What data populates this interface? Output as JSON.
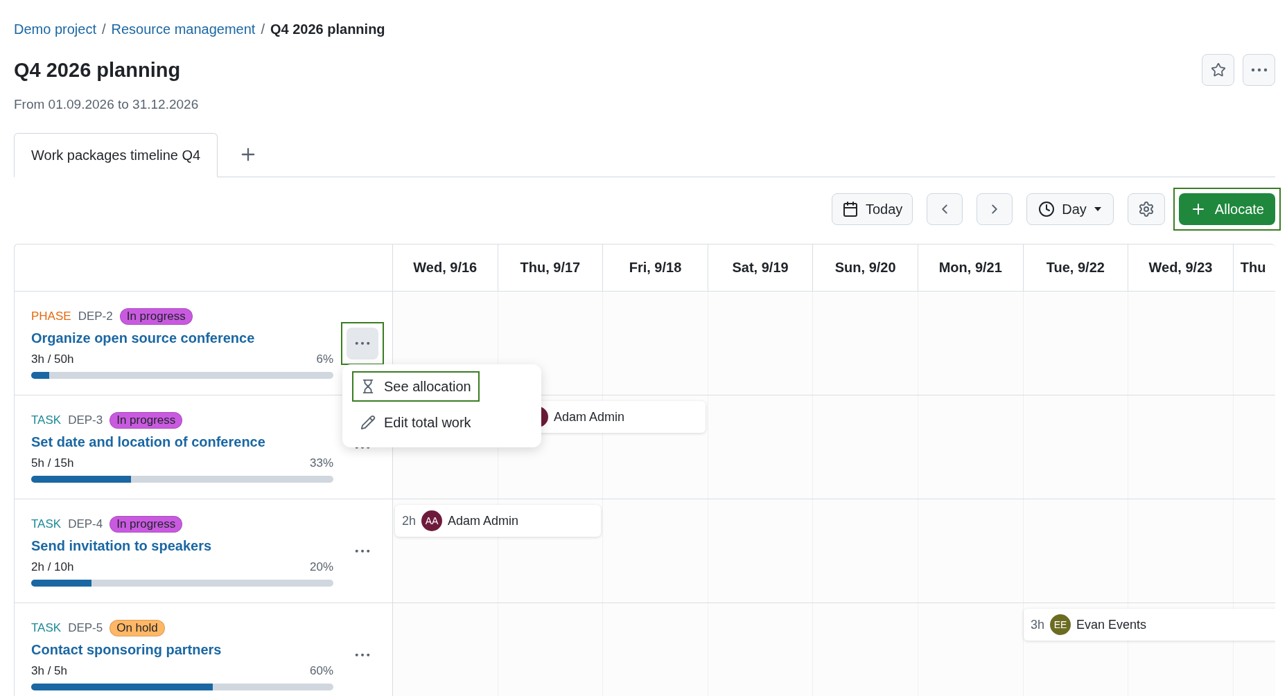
{
  "breadcrumb": [
    {
      "label": "Demo project",
      "kind": "link"
    },
    {
      "label": "Resource management",
      "kind": "link"
    },
    {
      "label": "Q4 2026 planning",
      "kind": "current"
    }
  ],
  "separator": "/",
  "title": "Q4 2026 planning",
  "subtitle": "From 01.09.2026 to 31.12.2026",
  "tabs": [
    {
      "label": "Work packages timeline Q4",
      "selected": true
    }
  ],
  "toolbar": [
    {
      "kind": "today",
      "label": "Today"
    },
    {
      "kind": "prev"
    },
    {
      "kind": "next"
    },
    {
      "kind": "view",
      "label": "Day"
    },
    {
      "kind": "settings"
    },
    {
      "kind": "allocate",
      "label": "Allocate",
      "highlighted": true
    }
  ],
  "days": [
    "Wed, 9/16",
    "Thu, 9/17",
    "Fri, 9/18",
    "Sat, 9/19",
    "Sun, 9/20",
    "Mon, 9/21",
    "Tue, 9/22",
    "Wed, 9/23",
    "Thu"
  ],
  "rows": [
    {
      "type": "PHASE",
      "kind": "phase",
      "id": "DEP-2",
      "status": {
        "label": "In progress",
        "color": "#c95ae0"
      },
      "title": "Organize open source conference",
      "work": "3h / 50h",
      "percent": "6%",
      "level": 0.06,
      "menu_open": true,
      "highlighted": true
    },
    {
      "type": "TASK",
      "kind": "task",
      "id": "DEP-3",
      "status": {
        "label": "In progress",
        "color": "#c95ae0"
      },
      "title": "Set date and location of conference",
      "work": "5h / 15h",
      "percent": "33%",
      "level": 0.33,
      "menu_open": false,
      "highlighted": false,
      "allocation": {
        "name": "Adam Admin",
        "color": "#6e1b3b"
      }
    },
    {
      "type": "TASK",
      "kind": "task",
      "id": "DEP-4",
      "status": {
        "label": "In progress",
        "color": "#c95ae0"
      },
      "title": "Send invitation to speakers",
      "work": "2h / 10h",
      "percent": "20%",
      "level": 0.2,
      "menu_open": false,
      "highlighted": false,
      "allocation": {
        "hours": "2h",
        "initials": "AA",
        "name": "Adam Admin",
        "color": "#6e1b3b"
      }
    },
    {
      "type": "TASK",
      "kind": "task",
      "id": "DEP-5",
      "status": {
        "label": "On hold",
        "color": "#ffb766"
      },
      "title": "Contact sponsoring partners",
      "work": "3h / 5h",
      "percent": "60%",
      "level": 0.6,
      "menu_open": false,
      "highlighted": false,
      "allocation": {
        "hours": "3h",
        "initials": "EE",
        "name": "Evan Events",
        "color": "#6b6b22"
      }
    }
  ],
  "menu": {
    "items": [
      {
        "label": "See allocation",
        "kind": "allocation",
        "highlighted": true
      },
      {
        "label": "Edit total work",
        "kind": "edit",
        "highlighted": false
      }
    ]
  }
}
